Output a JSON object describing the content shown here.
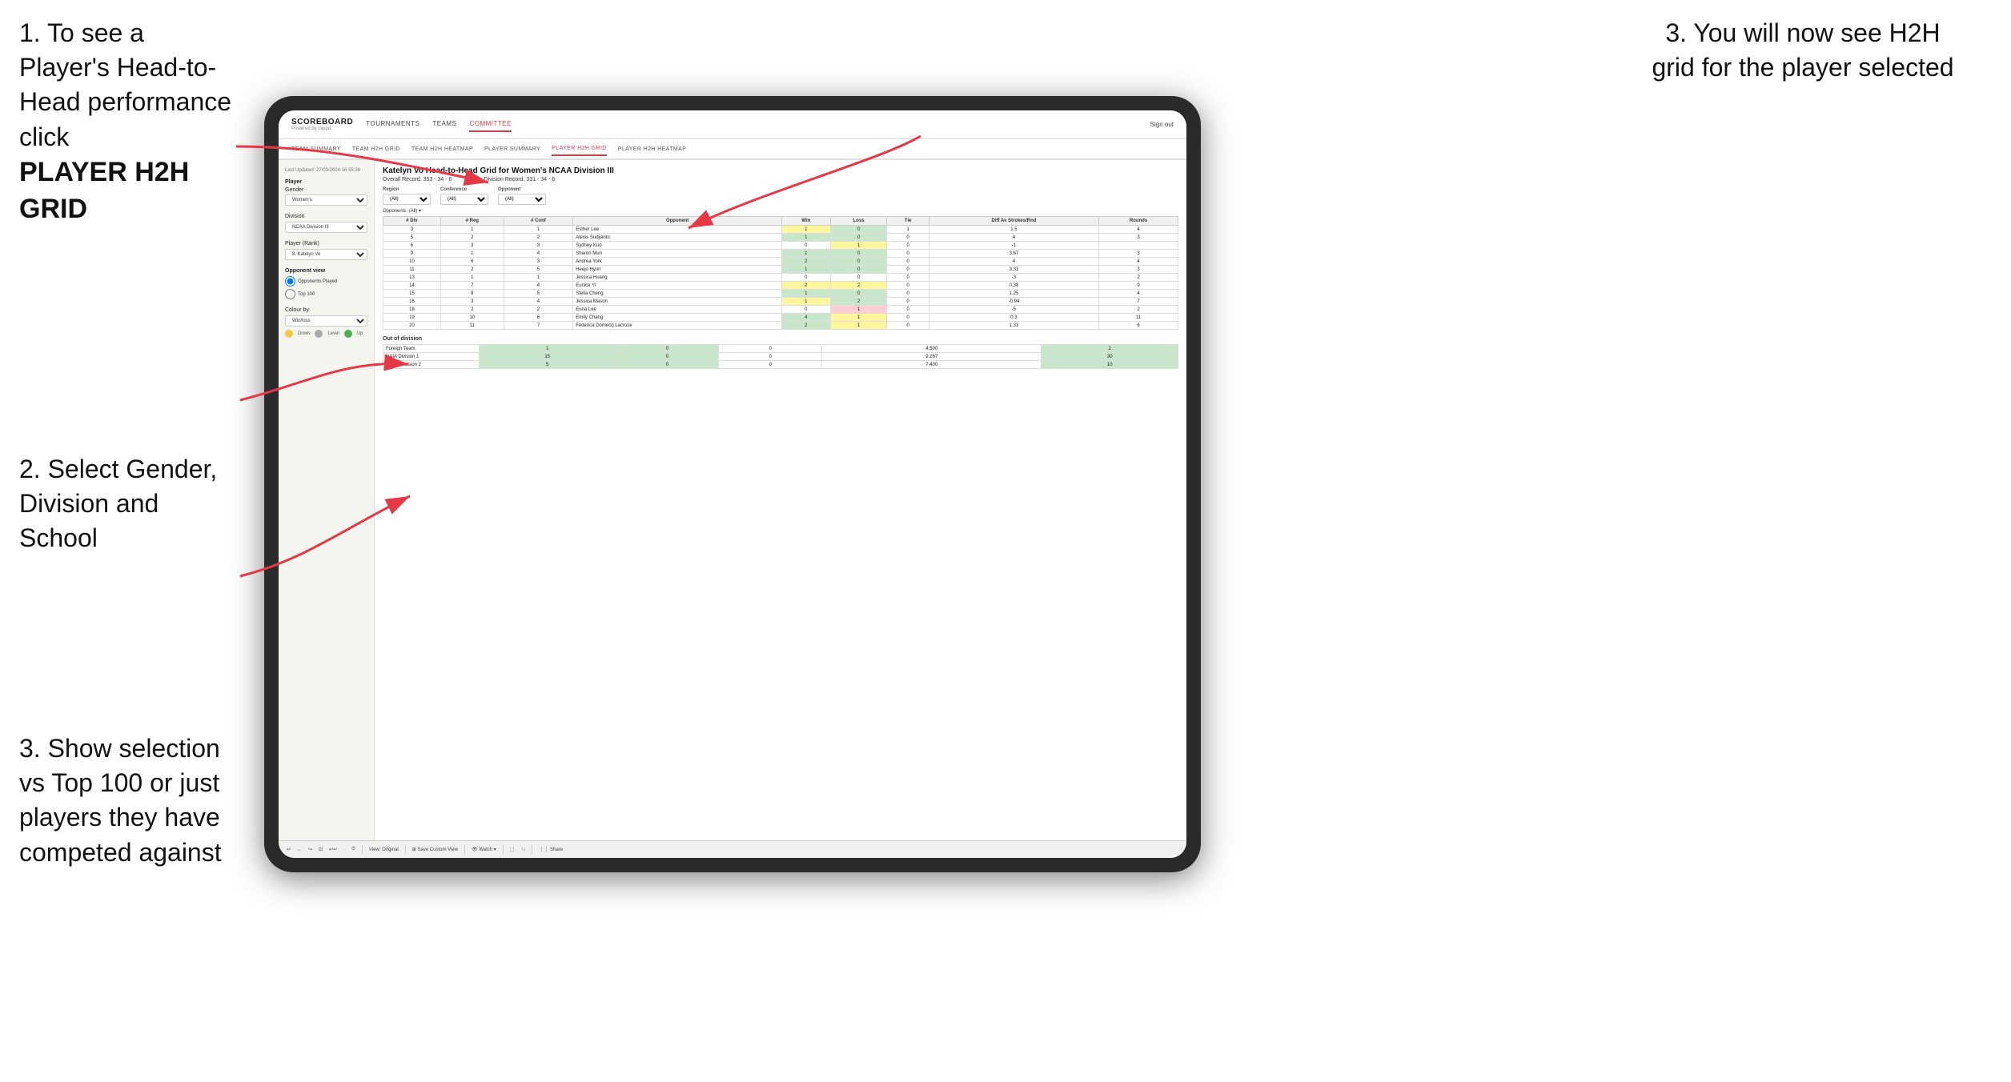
{
  "instructions": {
    "step1": {
      "text": "1. To see a Player's Head-to-Head performance click",
      "bold": "PLAYER H2H GRID"
    },
    "step2": {
      "text": "2. Select Gender, Division and School"
    },
    "step3_left": {
      "text": "3. Show selection vs Top 100 or just players they have competed against"
    },
    "step3_right": {
      "text": "3. You will now see H2H grid for the player selected"
    }
  },
  "nav": {
    "logo": "SCOREBOARD",
    "logo_sub": "Powered by clippd",
    "items": [
      "TOURNAMENTS",
      "TEAMS",
      "COMMITTEE"
    ],
    "sign_out": "Sign out"
  },
  "sub_nav": {
    "items": [
      "TEAM SUMMARY",
      "TEAM H2H GRID",
      "TEAM H2H HEATMAP",
      "PLAYER SUMMARY",
      "PLAYER H2H GRID",
      "PLAYER H2H HEATMAP"
    ],
    "active": "PLAYER H2H GRID"
  },
  "sidebar": {
    "timestamp": "Last Updated: 27/03/2024 16:55:38",
    "player_label": "Player",
    "gender_label": "Gender",
    "gender_value": "Women's",
    "division_label": "Division",
    "division_value": "NCAA Division III",
    "player_rank_label": "Player (Rank)",
    "player_rank_value": "8. Katelyn Vo",
    "opponent_view_label": "Opponent view",
    "radio_opponents": "Opponents Played",
    "radio_top100": "Top 100",
    "colour_by_label": "Colour by",
    "colour_value": "Win/loss",
    "legend": [
      {
        "color": "#f5c842",
        "label": "Down"
      },
      {
        "color": "#aaaaaa",
        "label": "Level"
      },
      {
        "color": "#4caf50",
        "label": "Up"
      }
    ]
  },
  "grid": {
    "title": "Katelyn Vo Head-to-Head Grid for Women's NCAA Division III",
    "overall_record_label": "Overall Record:",
    "overall_record": "353 - 34 - 6",
    "division_record_label": "Division Record:",
    "division_record": "331 - 34 - 6",
    "filters": {
      "region_label": "Region",
      "conference_label": "Conference",
      "opponent_label": "Opponent",
      "opponents_label": "Opponents:",
      "region_value": "(All)",
      "conference_value": "(All)",
      "opponent_value": "(All)"
    },
    "table_headers": [
      "# Div",
      "# Reg",
      "# Conf",
      "Opponent",
      "Win",
      "Loss",
      "Tie",
      "Diff Av Strokes/Rnd",
      "Rounds"
    ],
    "rows": [
      {
        "div": 3,
        "reg": 1,
        "conf": 1,
        "opponent": "Esther Lee",
        "win": 1,
        "loss": 0,
        "tie": 1,
        "diff": 1.5,
        "rounds": 4,
        "win_color": "yellow",
        "loss_color": "green"
      },
      {
        "div": 5,
        "reg": 2,
        "conf": 2,
        "opponent": "Alexis Sudjianto",
        "win": 1,
        "loss": 0,
        "tie": 0,
        "diff": 4.0,
        "rounds": 3,
        "win_color": "green",
        "loss_color": "green"
      },
      {
        "div": 6,
        "reg": 3,
        "conf": 3,
        "opponent": "Sydney Kuo",
        "win": 0,
        "loss": 1,
        "tie": 0,
        "diff": -1.0,
        "rounds": "",
        "win_color": "",
        "loss_color": "yellow"
      },
      {
        "div": 9,
        "reg": 1,
        "conf": 4,
        "opponent": "Sharon Mun",
        "win": 1,
        "loss": 0,
        "tie": 0,
        "diff": 3.67,
        "rounds": 3,
        "win_color": "green",
        "loss_color": "green"
      },
      {
        "div": 10,
        "reg": 6,
        "conf": 3,
        "opponent": "Andrea York",
        "win": 2,
        "loss": 0,
        "tie": 0,
        "diff": 4.0,
        "rounds": 4,
        "win_color": "green",
        "loss_color": "green"
      },
      {
        "div": 11,
        "reg": 2,
        "conf": 5,
        "opponent": "Heejo Hyun",
        "win": 1,
        "loss": 0,
        "tie": 0,
        "diff": 3.33,
        "rounds": 3,
        "win_color": "green",
        "loss_color": "green"
      },
      {
        "div": 13,
        "reg": 1,
        "conf": 1,
        "opponent": "Jessica Huang",
        "win": 0,
        "loss": 0,
        "tie": 0,
        "diff": -3.0,
        "rounds": 2,
        "win_color": "",
        "loss_color": ""
      },
      {
        "div": 14,
        "reg": 7,
        "conf": 4,
        "opponent": "Eunice Yi",
        "win": 2,
        "loss": 2,
        "tie": 0,
        "diff": 0.38,
        "rounds": 9,
        "win_color": "yellow",
        "loss_color": "yellow"
      },
      {
        "div": 15,
        "reg": 8,
        "conf": 5,
        "opponent": "Stella Cheng",
        "win": 1,
        "loss": 0,
        "tie": 0,
        "diff": 1.25,
        "rounds": 4,
        "win_color": "green",
        "loss_color": "green"
      },
      {
        "div": 16,
        "reg": 3,
        "conf": 4,
        "opponent": "Jessica Mason",
        "win": 1,
        "loss": 2,
        "tie": 0,
        "diff": -0.94,
        "rounds": 7,
        "win_color": "yellow",
        "loss_color": "green"
      },
      {
        "div": 18,
        "reg": 2,
        "conf": 2,
        "opponent": "Euna Lee",
        "win": 0,
        "loss": 1,
        "tie": 0,
        "diff": -5.0,
        "rounds": 2,
        "win_color": "",
        "loss_color": "red"
      },
      {
        "div": 19,
        "reg": 10,
        "conf": 6,
        "opponent": "Emily Chang",
        "win": 4,
        "loss": 1,
        "tie": 0,
        "diff": 0.3,
        "rounds": 11,
        "win_color": "green",
        "loss_color": "yellow"
      },
      {
        "div": 20,
        "reg": 11,
        "conf": 7,
        "opponent": "Federica Domecq Lacroze",
        "win": 2,
        "loss": 1,
        "tie": 0,
        "diff": 1.33,
        "rounds": 6,
        "win_color": "green",
        "loss_color": "yellow"
      }
    ],
    "out_of_division": {
      "title": "Out of division",
      "rows": [
        {
          "opponent": "Foreign Team",
          "win": 1,
          "loss": 0,
          "tie": 0,
          "diff": 4.5,
          "rounds": 2
        },
        {
          "opponent": "NAIA Division 1",
          "win": 15,
          "loss": 0,
          "tie": 0,
          "diff": 9.267,
          "rounds": 30
        },
        {
          "opponent": "NCAA Division 2",
          "win": 5,
          "loss": 0,
          "tie": 0,
          "diff": 7.4,
          "rounds": 10
        }
      ]
    }
  },
  "toolbar": {
    "buttons": [
      "↩",
      "←",
      "↪",
      "⊡",
      "↩↩",
      "·",
      "⏱",
      "View: Original",
      "Save Custom View",
      "👁 Watch ▾",
      "⬚",
      "↑↓",
      "Share"
    ]
  }
}
